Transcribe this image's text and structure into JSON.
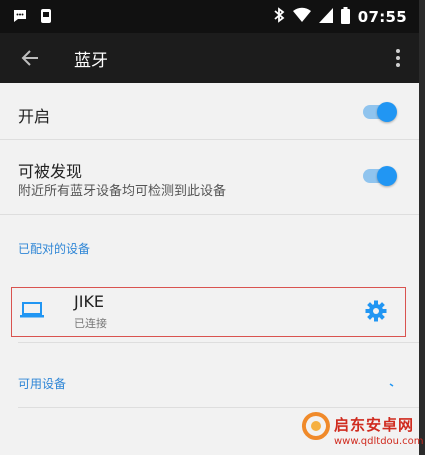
{
  "status_bar": {
    "time": "07:55",
    "icons": [
      "chat-icon",
      "phone-icon",
      "bluetooth-icon",
      "wifi-icon",
      "signal-icon",
      "battery-icon"
    ]
  },
  "app_bar": {
    "title": "蓝牙",
    "back_icon": "back-arrow-icon",
    "menu_icon": "more-vert-icon"
  },
  "settings": {
    "enable": {
      "label": "开启",
      "on": true
    },
    "discoverable": {
      "label": "可被发现",
      "subtitle": "附近所有蓝牙设备均可检测到此设备",
      "on": true
    }
  },
  "paired_section": {
    "header": "已配对的设备",
    "devices": [
      {
        "name": "JIKE",
        "status": "已连接",
        "icon": "laptop-icon",
        "settings_icon": "gear-icon"
      }
    ]
  },
  "available_section": {
    "header": "可用设备"
  },
  "watermark": {
    "title": "启东安卓网",
    "url": "www.qdltdou.com"
  },
  "colors": {
    "accent": "#2196f3",
    "status_bar": "#111111",
    "app_bar": "#1c1c1c",
    "background": "#f2f2f2",
    "highlight_border": "#d9534f",
    "section_header": "#2f86d6"
  }
}
